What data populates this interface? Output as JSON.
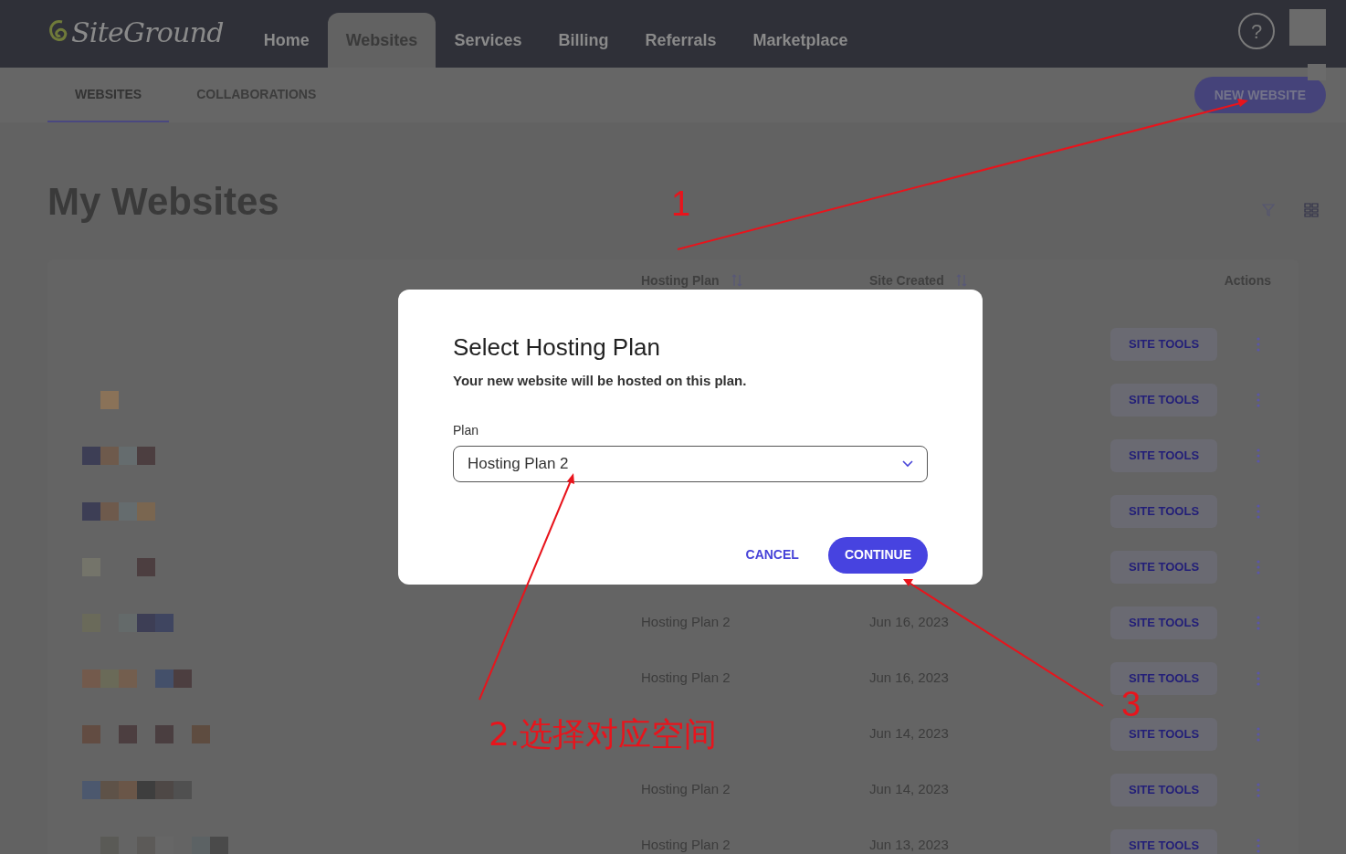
{
  "header": {
    "logo": "SiteGround",
    "nav": [
      {
        "label": "Home",
        "selected": false
      },
      {
        "label": "Websites",
        "selected": true
      },
      {
        "label": "Services",
        "selected": false
      },
      {
        "label": "Billing",
        "selected": false
      },
      {
        "label": "Referrals",
        "selected": false
      },
      {
        "label": "Marketplace",
        "selected": false
      }
    ],
    "help": "?"
  },
  "subtabs": [
    {
      "label": "WEBSITES",
      "selected": true
    },
    {
      "label": "COLLABORATIONS",
      "selected": false
    }
  ],
  "new_website_button": "NEW WEBSITE",
  "page_title": "My Websites",
  "table": {
    "columns": [
      "Hosting Plan",
      "Site Created",
      "Actions"
    ],
    "rows": [
      {
        "action": "SITE TOOLS"
      },
      {
        "action": "SITE TOOLS"
      },
      {
        "action": "SITE TOOLS"
      },
      {
        "action": "SITE TOOLS"
      },
      {
        "action": "SITE TOOLS"
      },
      {
        "plan": "Hosting Plan 2",
        "created": "Jun 16, 2023",
        "action": "SITE TOOLS"
      },
      {
        "plan": "Hosting Plan 2",
        "created": "Jun 16, 2023",
        "action": "SITE TOOLS"
      },
      {
        "created": "Jun 14, 2023",
        "action": "SITE TOOLS"
      },
      {
        "plan": "Hosting Plan 2",
        "created": "Jun 14, 2023",
        "action": "SITE TOOLS"
      },
      {
        "plan": "Hosting Plan 2",
        "created": "Jun 13, 2023",
        "action": "SITE TOOLS"
      }
    ]
  },
  "modal": {
    "title": "Select Hosting Plan",
    "subtitle": "Your new website will be hosted on this plan.",
    "field_label": "Plan",
    "field_value": "Hosting Plan 2",
    "cancel": "CANCEL",
    "continue": "CONTINUE"
  },
  "annotations": [
    {
      "kind": "number",
      "text": "1"
    },
    {
      "kind": "label",
      "text": "2.选择对应空间"
    },
    {
      "kind": "number",
      "text": "3"
    }
  ]
}
